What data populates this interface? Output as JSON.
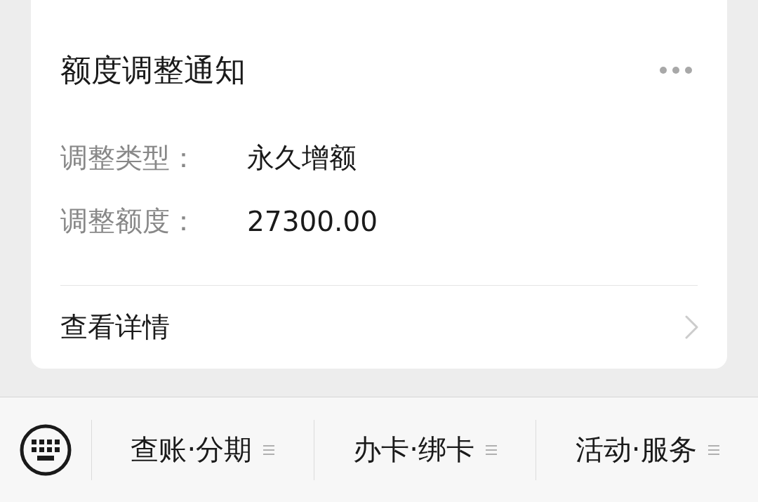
{
  "card": {
    "title": "额度调整通知",
    "fields": [
      {
        "label": "调整类型：",
        "value": "永久增额"
      },
      {
        "label": "调整额度：",
        "value": "27300.00"
      }
    ],
    "link": "查看详情"
  },
  "menu_bar": {
    "items": [
      "查账·分期",
      "办卡·绑卡",
      "活动·服务"
    ]
  }
}
